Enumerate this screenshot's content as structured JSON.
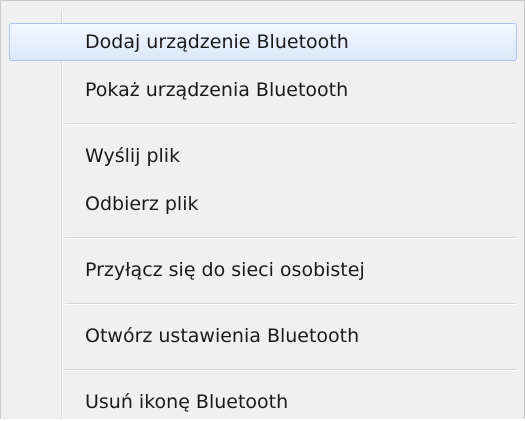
{
  "context_menu": {
    "items": [
      {
        "label": "Dodaj urządzenie Bluetooth",
        "highlighted": true
      },
      {
        "label": "Pokaż urządzenia Bluetooth"
      },
      {
        "label": "Wyślij plik"
      },
      {
        "label": "Odbierz plik"
      },
      {
        "label": "Przyłącz się do sieci osobistej"
      },
      {
        "label": "Otwórz ustawienia Bluetooth"
      },
      {
        "label": "Usuń ikonę Bluetooth"
      }
    ],
    "colors": {
      "menu_background": "#f0f0f0",
      "highlight_border": "#a9c5ea",
      "highlight_top": "#f2f7fe",
      "highlight_bottom": "#dbe8fb",
      "separator": "#d6d6d6",
      "text": "#1a1a1a"
    }
  }
}
